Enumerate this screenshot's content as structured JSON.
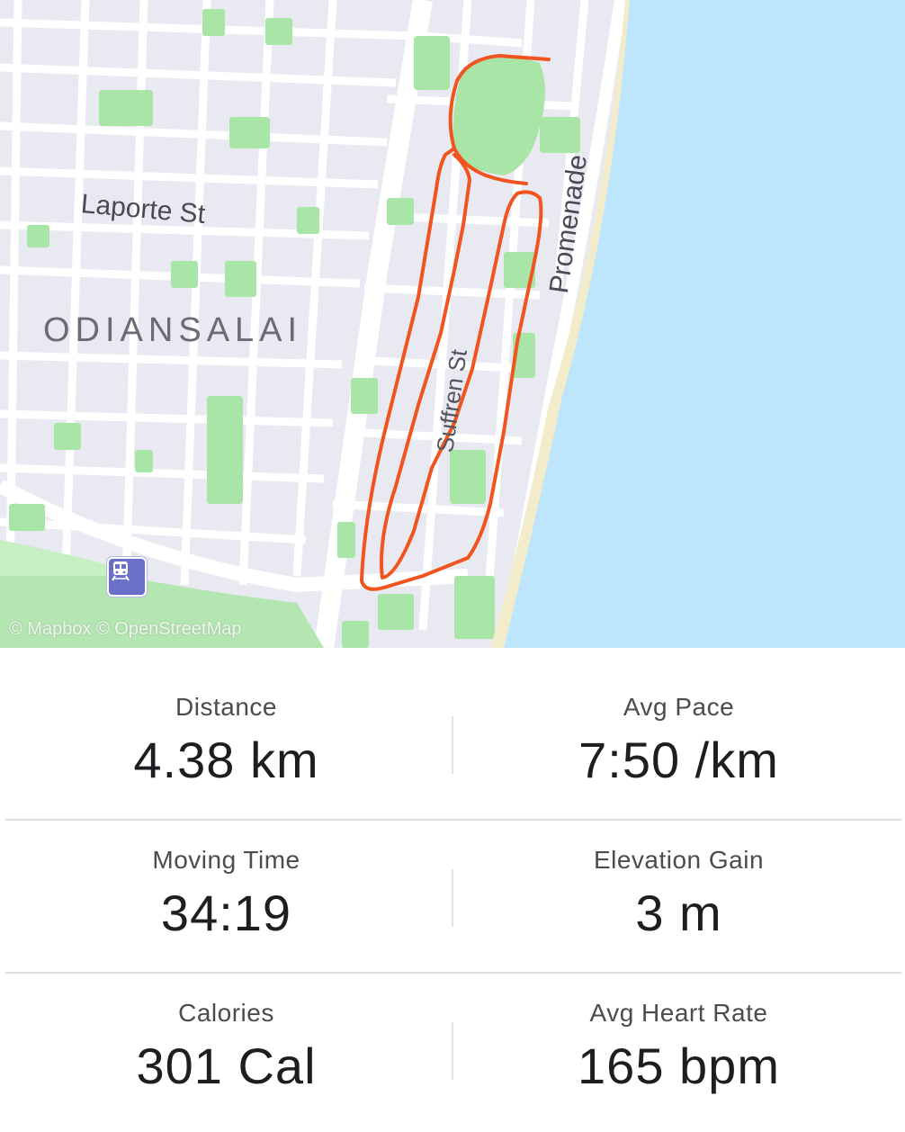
{
  "map": {
    "neighborhood_label": "ODIANSALAI",
    "street_labels": [
      "Laporte St",
      "Suffren St",
      "Promenade"
    ],
    "attribution": "© Mapbox © OpenStreetMap",
    "colors": {
      "land": "#e9e9f2",
      "road": "#ffffff",
      "park": "#a8e5a6",
      "water": "#bde5fb",
      "route": "#f1541f"
    },
    "transit_icon": "train-station-icon"
  },
  "stats": {
    "distance": {
      "label": "Distance",
      "value": "4.38 km"
    },
    "avg_pace": {
      "label": "Avg Pace",
      "value": "7:50 /km"
    },
    "moving_time": {
      "label": "Moving Time",
      "value": "34:19"
    },
    "elevation_gain": {
      "label": "Elevation Gain",
      "value": "3 m"
    },
    "calories": {
      "label": "Calories",
      "value": "301 Cal"
    },
    "avg_heart_rate": {
      "label": "Avg Heart Rate",
      "value": "165 bpm"
    }
  }
}
